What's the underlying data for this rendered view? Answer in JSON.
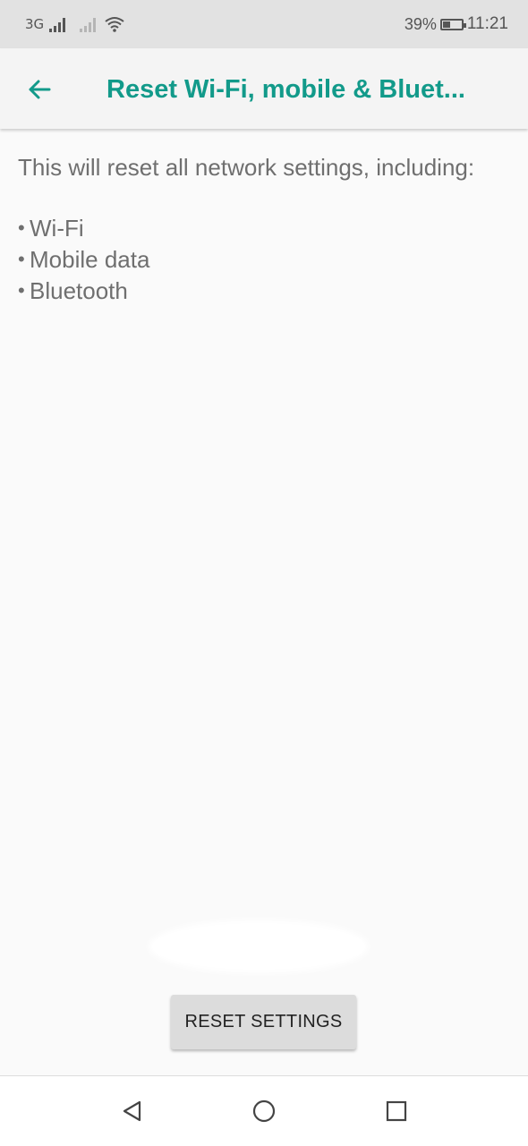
{
  "status_bar": {
    "network_type": "3G",
    "signal_1_icon": "signal-strength-icon",
    "signal_2_icon": "signal-strength-empty-icon",
    "wifi_icon": "wifi-icon",
    "battery_percent": "39%",
    "battery_level": 0.39,
    "time": "11:21"
  },
  "app_bar": {
    "back_icon": "arrow-back-icon",
    "title": "Reset Wi-Fi, mobile & Bluet..."
  },
  "content": {
    "intro": "This will reset all network settings, including:",
    "items": [
      {
        "bullet": "•",
        "label": "Wi-Fi"
      },
      {
        "bullet": "•",
        "label": "Mobile data"
      },
      {
        "bullet": "•",
        "label": "Bluetooth"
      }
    ]
  },
  "actions": {
    "reset_label": "RESET SETTINGS"
  },
  "nav_bar": {
    "back_icon": "nav-back-icon",
    "home_icon": "nav-home-icon",
    "recents_icon": "nav-recents-icon"
  },
  "colors": {
    "accent": "#129a8a",
    "status_bar_bg": "#e2e2e2",
    "app_bar_bg": "#f4f4f4",
    "page_bg": "#fafafa",
    "body_text": "#6f6f6f",
    "button_bg": "#dcdcdc"
  }
}
